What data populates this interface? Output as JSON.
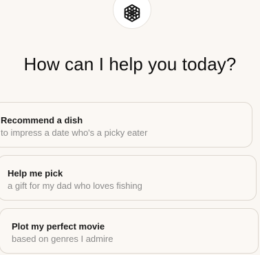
{
  "logo": {
    "icon": "openai-logo-icon"
  },
  "title": "How can I help you today?",
  "suggestions": [
    {
      "title": "Recommend a dish",
      "subtitle": "to impress a date who's a picky eater"
    },
    {
      "title": "Help me pick",
      "subtitle": "a gift for my dad who loves fishing"
    },
    {
      "title": "Plot my perfect movie",
      "subtitle": "based on genres I admire"
    }
  ]
}
